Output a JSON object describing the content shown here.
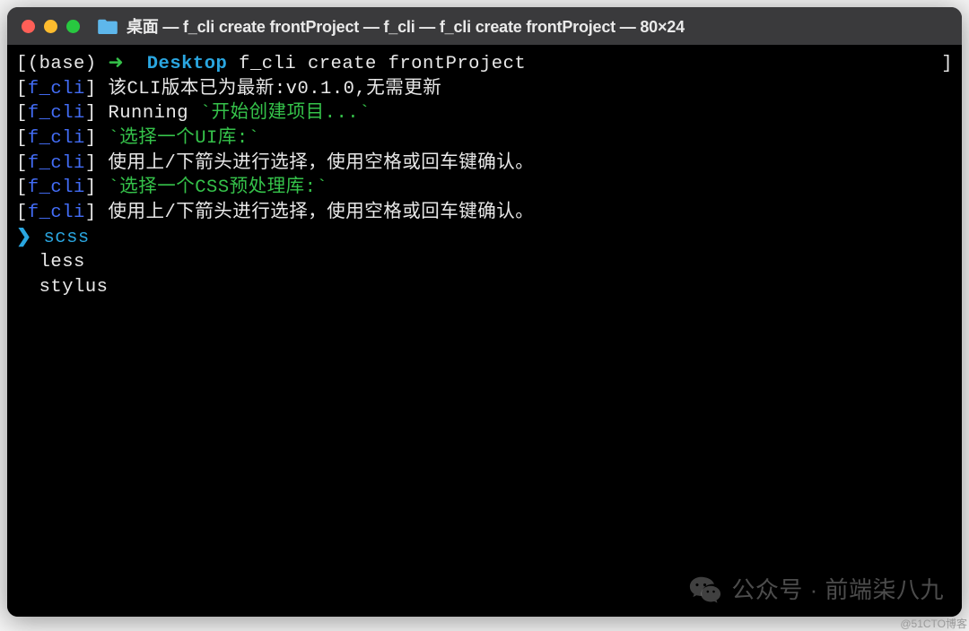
{
  "titlebar": {
    "title": "桌面 — f_cli create frontProject — f_cli — f_cli create frontProject — 80×24"
  },
  "prompt": {
    "open_bracket": "[",
    "base": "(base)",
    "arrow": "➜  ",
    "cwd": "Desktop",
    "command": " f_cli create frontProject"
  },
  "right_bracket": "]",
  "tag_label": "f_cli",
  "lines": {
    "l1_text": " 该CLI版本已为最新:v0.1.0,无需更新",
    "l2_running": " Running ",
    "l2_green": "`开始创建项目...`",
    "l3_green": "`选择一个UI库:`",
    "l4_text": " 使用上/下箭头进行选择，使用空格或回车键确认。",
    "l5_green": "`选择一个CSS预处理库:`",
    "l6_text": " 使用上/下箭头进行选择，使用空格或回车键确认。"
  },
  "selector": {
    "pointer": "❯",
    "options": {
      "o0": "scss",
      "o1": "less",
      "o2": "stylus"
    }
  },
  "watermark": {
    "text": "公众号 · 前端柒八九"
  },
  "attribution": "@51CTO博客"
}
